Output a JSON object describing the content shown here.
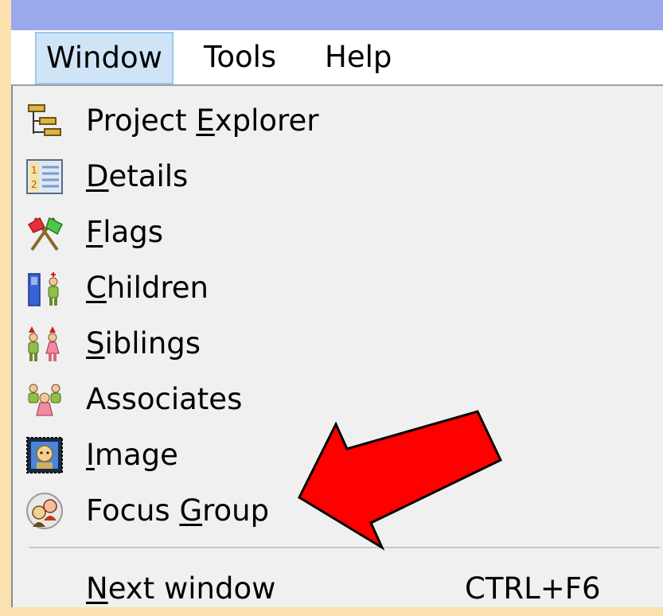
{
  "menubar": {
    "items": [
      {
        "label": "Window",
        "active": true
      },
      {
        "label": "Tools",
        "active": false
      },
      {
        "label": "Help",
        "active": false
      }
    ]
  },
  "menu": {
    "items": [
      {
        "pre": "Project ",
        "ul": "E",
        "post": "xplorer",
        "icon": "project-explorer-icon"
      },
      {
        "pre": "",
        "ul": "D",
        "post": "etails",
        "icon": "details-icon"
      },
      {
        "pre": "",
        "ul": "F",
        "post": "lags",
        "icon": "flags-icon"
      },
      {
        "pre": "",
        "ul": "C",
        "post": "hildren",
        "icon": "children-icon"
      },
      {
        "pre": "",
        "ul": "S",
        "post": "iblings",
        "icon": "siblings-icon"
      },
      {
        "pre": "Associates",
        "ul": "",
        "post": "",
        "icon": "associates-icon"
      },
      {
        "pre": "",
        "ul": "I",
        "post": "mage",
        "icon": "image-icon"
      },
      {
        "pre": "Focus ",
        "ul": "G",
        "post": "roup",
        "icon": "focus-group-icon"
      }
    ],
    "next_window": {
      "pre": "",
      "ul": "N",
      "post": "ext window",
      "shortcut": "CTRL+F6"
    }
  },
  "colors": {
    "background": "#fbe1ad",
    "titlebar": "#9aa8ec",
    "menu_bg": "#f0f0f0",
    "active_menu": "#cfe5f7",
    "arrow": "#ff0000"
  }
}
